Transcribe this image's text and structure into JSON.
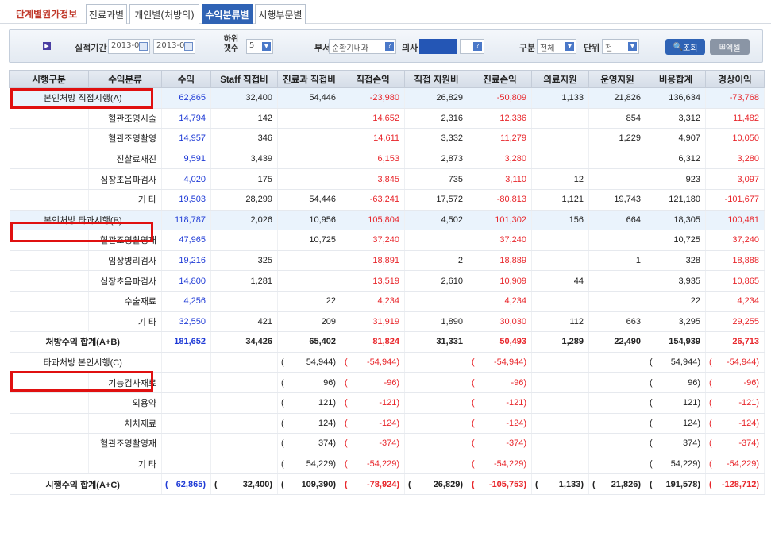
{
  "app": {
    "title": "단계별원가정보"
  },
  "tabs": [
    {
      "label": "진료과별"
    },
    {
      "label": "개인별(처방의)"
    },
    {
      "label": "수익분류별",
      "active": true
    },
    {
      "label": "시행부문별"
    }
  ],
  "filters": {
    "period_label": "실적기간",
    "period_from": "2013-04",
    "period_to": "2013-04",
    "sub_count_label": "하위 갯수",
    "sub_count_value": "5",
    "dept_label": "부서",
    "dept_value": "순환기내과",
    "doctor_label": "의사",
    "category_label": "구분",
    "category_value": "전체",
    "unit_label": "단위",
    "unit_value": "천",
    "search_label": "조회",
    "excel_label": "엑셀"
  },
  "columns": [
    "시행구분",
    "수익분류",
    "수익",
    "Staff 직접비",
    "진료과 직접비",
    "직접손익",
    "직접 지원비",
    "진료손익",
    "의료지원",
    "운영지원",
    "비용합계",
    "경상이익"
  ],
  "rows": [
    {
      "group": "본인처방 직접시행(A)",
      "label": "",
      "values": [
        "62,865",
        "32,400",
        "54,446",
        "-23,980",
        "26,829",
        "-50,809",
        "1,133",
        "21,826",
        "136,634",
        "-73,768"
      ],
      "type": "group"
    },
    {
      "group": "",
      "label": "혈관조영시술",
      "values": [
        "14,794",
        "142",
        "",
        "14,652",
        "2,316",
        "12,336",
        "",
        "854",
        "3,312",
        "11,482"
      ]
    },
    {
      "group": "",
      "label": "혈관조영촬영",
      "values": [
        "14,957",
        "346",
        "",
        "14,611",
        "3,332",
        "11,279",
        "",
        "1,229",
        "4,907",
        "10,050"
      ]
    },
    {
      "group": "",
      "label": "진찰료재진",
      "values": [
        "9,591",
        "3,439",
        "",
        "6,153",
        "2,873",
        "3,280",
        "",
        "",
        "6,312",
        "3,280"
      ]
    },
    {
      "group": "",
      "label": "심장초음파검사",
      "values": [
        "4,020",
        "175",
        "",
        "3,845",
        "735",
        "3,110",
        "12",
        "",
        "923",
        "3,097"
      ]
    },
    {
      "group": "",
      "label": "기 타",
      "values": [
        "19,503",
        "28,299",
        "54,446",
        "-63,241",
        "17,572",
        "-80,813",
        "1,121",
        "19,743",
        "121,180",
        "-101,677"
      ]
    },
    {
      "group": "본인처방 타과시행(B)",
      "label": "",
      "values": [
        "118,787",
        "2,026",
        "10,956",
        "105,804",
        "4,502",
        "101,302",
        "156",
        "664",
        "18,305",
        "100,481"
      ],
      "type": "group"
    },
    {
      "group": "",
      "label": "혈관조영촬영재",
      "values": [
        "47,965",
        "",
        "10,725",
        "37,240",
        "",
        "37,240",
        "",
        "",
        "10,725",
        "37,240"
      ]
    },
    {
      "group": "",
      "label": "임상병리검사",
      "values": [
        "19,216",
        "325",
        "",
        "18,891",
        "2",
        "18,889",
        "",
        "1",
        "328",
        "18,888"
      ]
    },
    {
      "group": "",
      "label": "심장초음파검사",
      "values": [
        "14,800",
        "1,281",
        "",
        "13,519",
        "2,610",
        "10,909",
        "44",
        "",
        "3,935",
        "10,865"
      ]
    },
    {
      "group": "",
      "label": "수술재료",
      "values": [
        "4,256",
        "",
        "22",
        "4,234",
        "",
        "4,234",
        "",
        "",
        "22",
        "4,234"
      ]
    },
    {
      "group": "",
      "label": "기 타",
      "values": [
        "32,550",
        "421",
        "209",
        "31,919",
        "1,890",
        "30,030",
        "112",
        "663",
        "3,295",
        "29,255"
      ]
    },
    {
      "group": "처방수익 합계(A+B)",
      "label": "",
      "values": [
        "181,652",
        "34,426",
        "65,402",
        "81,824",
        "31,331",
        "50,493",
        "1,289",
        "22,490",
        "154,939",
        "26,713"
      ],
      "type": "total"
    },
    {
      "group": "타과처방 본인시행(C)",
      "label": "",
      "values": [
        "",
        "",
        "54,944)",
        "-54,944)",
        "",
        "-54,944)",
        "",
        "",
        "54,944)",
        "-54,944)"
      ],
      "type": "groupneg"
    },
    {
      "group": "",
      "label": "기능검사재료",
      "values": [
        "",
        "",
        "96)",
        "-96)",
        "",
        "-96)",
        "",
        "",
        "96)",
        "-96)"
      ]
    },
    {
      "group": "",
      "label": "외용약",
      "values": [
        "",
        "",
        "121)",
        "-121)",
        "",
        "-121)",
        "",
        "",
        "121)",
        "-121)"
      ]
    },
    {
      "group": "",
      "label": "처치재료",
      "values": [
        "",
        "",
        "124)",
        "-124)",
        "",
        "-124)",
        "",
        "",
        "124)",
        "-124)"
      ]
    },
    {
      "group": "",
      "label": "혈관조영촬영재",
      "values": [
        "",
        "",
        "374)",
        "-374)",
        "",
        "-374)",
        "",
        "",
        "374)",
        "-374)"
      ]
    },
    {
      "group": "",
      "label": "기 타",
      "values": [
        "",
        "",
        "54,229)",
        "-54,229)",
        "",
        "-54,229)",
        "",
        "",
        "54,229)",
        "-54,229)"
      ]
    },
    {
      "group": "시행수익 합계(A+C)",
      "label": "",
      "values": [
        "62,865)",
        "32,400)",
        "109,390)",
        "-78,924)",
        "26,829)",
        "-105,753)",
        "1,133)",
        "21,826)",
        "191,578)",
        "-128,712)"
      ],
      "type": "grand"
    }
  ]
}
